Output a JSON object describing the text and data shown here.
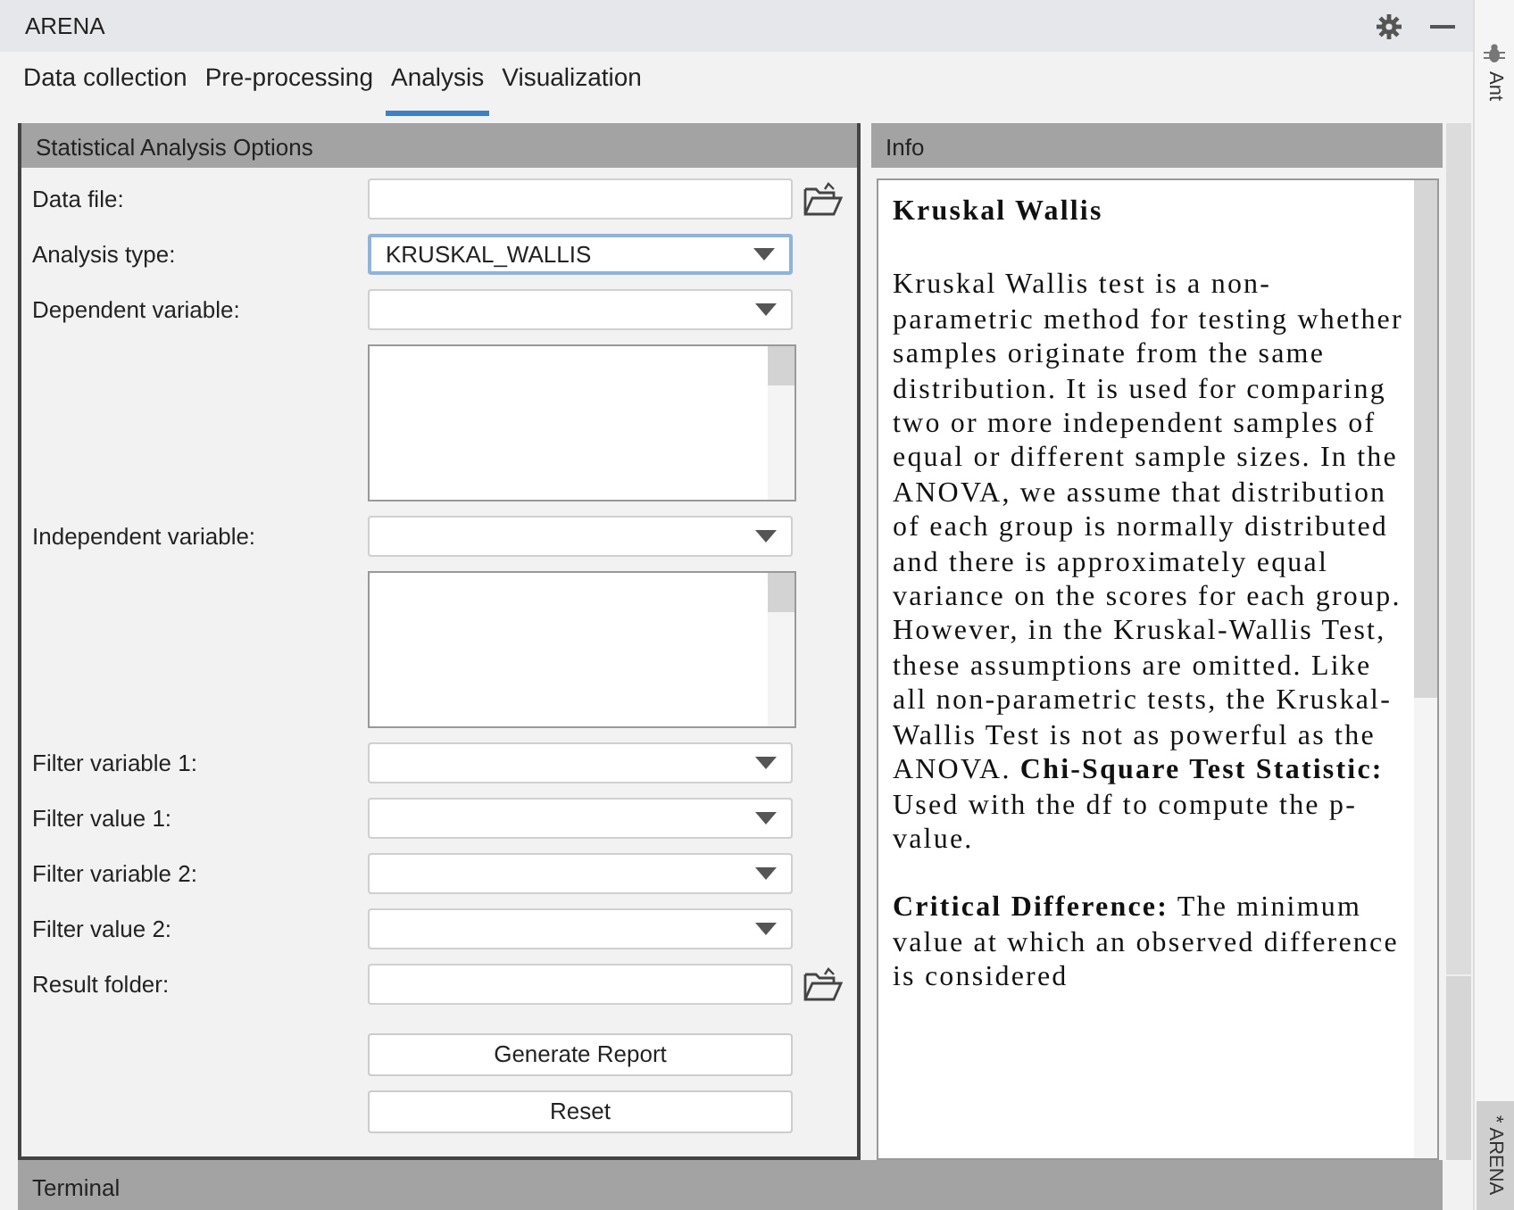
{
  "window": {
    "title": "ARENA"
  },
  "tabs": [
    {
      "label": "Data collection",
      "selected": false
    },
    {
      "label": "Pre-processing",
      "selected": false
    },
    {
      "label": "Analysis",
      "selected": true
    },
    {
      "label": "Visualization",
      "selected": false
    }
  ],
  "options_panel": {
    "title": "Statistical Analysis Options",
    "rows": [
      {
        "kind": "file",
        "label": "Data file:",
        "focused": false
      },
      {
        "kind": "combo",
        "label": "Analysis type:",
        "value": "KRUSKAL_WALLIS",
        "focused": true
      },
      {
        "kind": "combo",
        "label": "Dependent variable:",
        "focused": false
      },
      {
        "kind": "list",
        "focused": false
      },
      {
        "kind": "combo",
        "label": "Independent variable:",
        "focused": false
      },
      {
        "kind": "list",
        "focused": false
      },
      {
        "kind": "combo",
        "label": "Filter variable 1:",
        "focused": false
      },
      {
        "kind": "combo",
        "label": "Filter value 1:",
        "focused": false
      },
      {
        "kind": "combo",
        "label": "Filter variable 2:",
        "focused": false
      },
      {
        "kind": "combo",
        "label": "Filter value 2:",
        "focused": false
      },
      {
        "kind": "file",
        "label": "Result folder:",
        "focused": false
      }
    ],
    "buttons": [
      "Generate Report",
      "Reset"
    ]
  },
  "info_panel": {
    "title": "Info",
    "heading": "Kruskal Wallis",
    "paragraphs": [
      "Kruskal Wallis test is a non-parametric method for testing whether samples originate from the same distribution. It is used for comparing two or more independent samples of equal or different sample sizes. In the ANOVA, we assume that distribution of each group is normally distributed and there is approximately equal variance on the scores for each group. However, in the Kruskal-Wallis Test, these assumptions are omitted. Like all non-parametric tests, the Kruskal-Wallis Test is not as powerful as the ANOVA. **Chi-Square Test Statistic:** Used with the df to compute the p-value.",
      "**Critical Difference:** The minimum value at which an observed difference is considered"
    ]
  },
  "bottom_panel": {
    "title": "Terminal"
  },
  "side_strip": {
    "top_label": "Ant",
    "bottom_label": "* ARENA"
  }
}
